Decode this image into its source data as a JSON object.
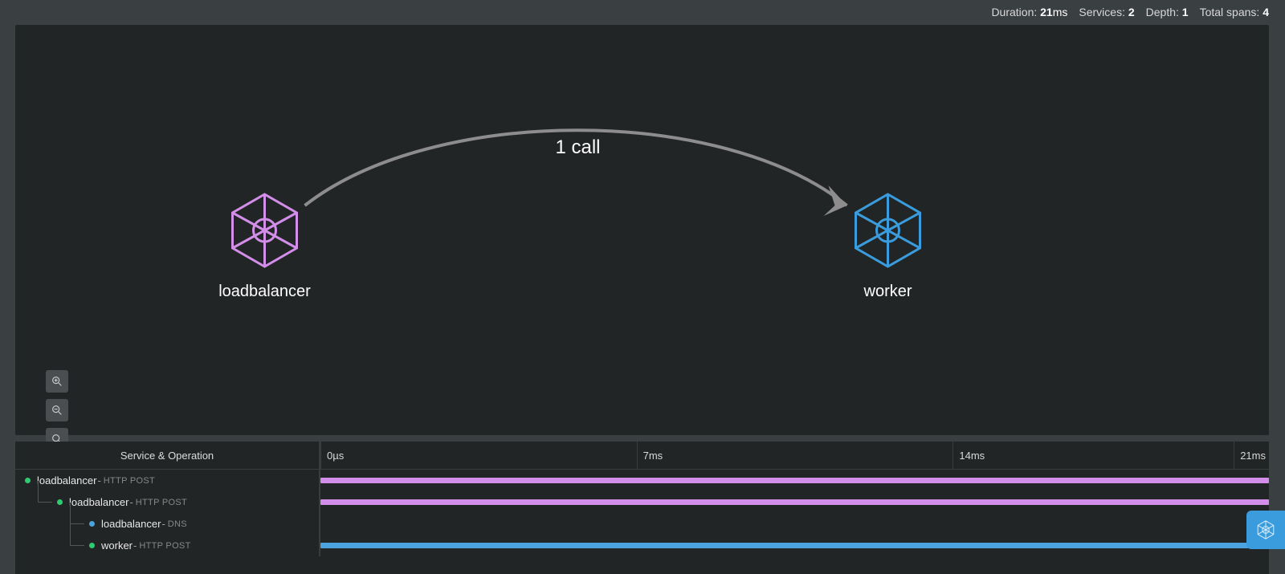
{
  "stats": {
    "duration_label": "Duration:",
    "duration_value": "21",
    "duration_unit": "ms",
    "services_label": "Services:",
    "services_value": "2",
    "depth_label": "Depth:",
    "depth_value": "1",
    "totalspans_label": "Total spans:",
    "totalspans_value": "4"
  },
  "graph": {
    "edge_label": "1 call",
    "nodes": [
      {
        "id": "loadbalancer",
        "label": "loadbalancer",
        "color": "#d28ee8"
      },
      {
        "id": "worker",
        "label": "worker",
        "color": "#3b9cdd"
      }
    ]
  },
  "timeline": {
    "header": "Service & Operation",
    "ticks": [
      {
        "label": "0µs",
        "pos": 0.0
      },
      {
        "label": "7ms",
        "pos": 0.3333
      },
      {
        "label": "14ms",
        "pos": 0.6667
      },
      {
        "label": "21ms",
        "pos": 1.0
      }
    ],
    "rows": [
      {
        "indent": 0,
        "dot": "#2ecc71",
        "service": "loadbalancer",
        "operation": "HTTP POST",
        "bar_color": "#d28ee8",
        "bar_start": 0.0,
        "bar_end": 1.0
      },
      {
        "indent": 1,
        "dot": "#2ecc71",
        "service": "loadbalancer",
        "operation": "HTTP POST",
        "bar_color": "#d28ee8",
        "bar_start": 0.0,
        "bar_end": 1.0
      },
      {
        "indent": 2,
        "dot": "#4aa3df",
        "service": "loadbalancer",
        "operation": "DNS",
        "bar_color": "",
        "bar_start": 0.0,
        "bar_end": 0.0
      },
      {
        "indent": 2,
        "dot": "#2ecc71",
        "service": "worker",
        "operation": "HTTP POST",
        "bar_color": "#4aa3df",
        "bar_start": 0.0,
        "bar_end": 1.0
      }
    ]
  },
  "colors": {
    "purple": "#d28ee8",
    "blue": "#3b9cdd",
    "green": "#2ecc71"
  }
}
